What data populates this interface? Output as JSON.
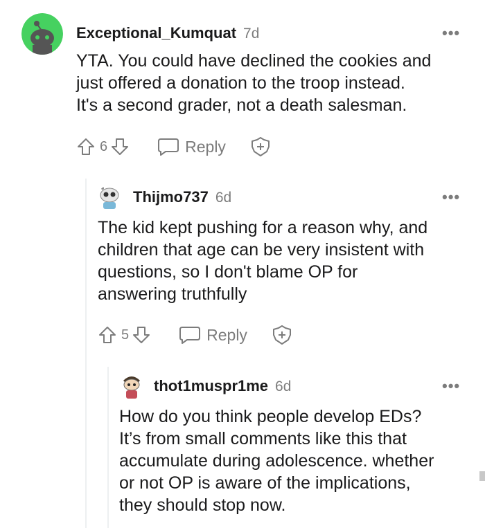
{
  "comments": [
    {
      "username": "Exceptional_Kumquat",
      "age": "7d",
      "body": "YTA. You could have declined the cookies and\njust offered a donation to the troop instead.\nIt's a second grader, not a death salesman.",
      "score": "6",
      "reply_label": "Reply",
      "more_label": "•••",
      "avatar_color": "#46d160"
    },
    {
      "username": "Thijmo737",
      "age": "6d",
      "body": "The kid kept pushing for a reason why, and\nchildren that age can be very insistent with\nquestions, so I don't blame OP for\nanswering truthfully",
      "score": "5",
      "reply_label": "Reply",
      "more_label": "•••"
    },
    {
      "username": "thot1muspr1me",
      "age": "6d",
      "body": "How do you think people develop EDs?\nIt’s from small comments like this that\naccumulate during adolescence. whether\nor not OP is aware of the implications,\nthey should stop now.",
      "more_label": "•••"
    }
  ],
  "colors": {
    "text": "#1a1a1b",
    "meta": "#7c7c7c",
    "thread_line": "#edeff1",
    "accent_green": "#46d160"
  }
}
